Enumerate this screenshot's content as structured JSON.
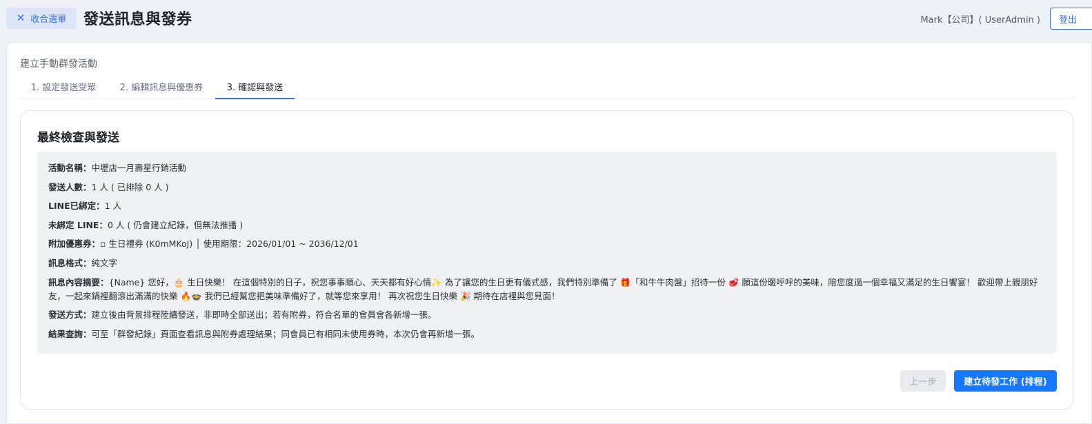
{
  "header": {
    "collapse_label": "收合選單",
    "title": "發送訊息與發券",
    "user": "Mark【公司】( UserAdmin )",
    "logout_label": "登出"
  },
  "section_title": "建立手動群發活動",
  "tabs": [
    {
      "label": "1. 設定發送受眾",
      "active": false
    },
    {
      "label": "2. 編輯訊息與優惠券",
      "active": false
    },
    {
      "label": "3. 確認與發送",
      "active": true
    }
  ],
  "review": {
    "title": "最終檢查與發送",
    "rows": {
      "activity_name": {
        "label": "活動名稱：",
        "value": "中壢店一月壽星行銷活動"
      },
      "send_count": {
        "label": "發送人數：",
        "value": "1 人 ( 已排除 0 人 )"
      },
      "line_bound": {
        "label": "LINE已綁定：",
        "value": "1 人"
      },
      "line_unbound": {
        "label": "未綁定 LINE：",
        "value": "0 人 ( 仍會建立紀錄，但無法推播 )"
      },
      "coupon": {
        "label": "附加優惠券：",
        "value": "▫ 生日禮券 (K0mMKoJ) │ 使用期限：2026/01/01 ~ 2036/12/01"
      },
      "format": {
        "label": "訊息格式：",
        "value": "純文字"
      },
      "content": {
        "label": "訊息內容摘要：",
        "value": "{Name} 您好，🎂 生日快樂！ 在這個特別的日子，祝您事事順心、天天都有好心情✨ 為了讓您的生日更有儀式感，我們特別準備了 🎁「和牛牛肉盤」招待一份 🥩 願這份暖呼呼的美味，陪您度過一個幸福又滿足的生日饗宴！ 歡迎帶上親朋好友，一起來鍋裡翻滾出滿滿的快樂 🔥🍲 我們已經幫您把美味準備好了，就等您來享用！ 再次祝您生日快樂 🎉 期待在店裡與您見面！"
      },
      "send_method": {
        "label": "發送方式：",
        "value": "建立後由背景排程陸續發送，非即時全部送出；若有附券，符合名單的會員會各新增一張。"
      },
      "result_query": {
        "label": "結果查詢：",
        "value": "可至「群發紀錄」頁面查看訊息與附券處理結果；同會員已有相同未使用券時，本次仍會再新增一張。"
      }
    }
  },
  "actions": {
    "prev_label": "上一步",
    "create_label": "建立待發工作 (排程)"
  },
  "colors": {
    "accent": "#3a6fd8",
    "primary_button": "#1677ff",
    "summary_bg": "#f0f1f3"
  }
}
